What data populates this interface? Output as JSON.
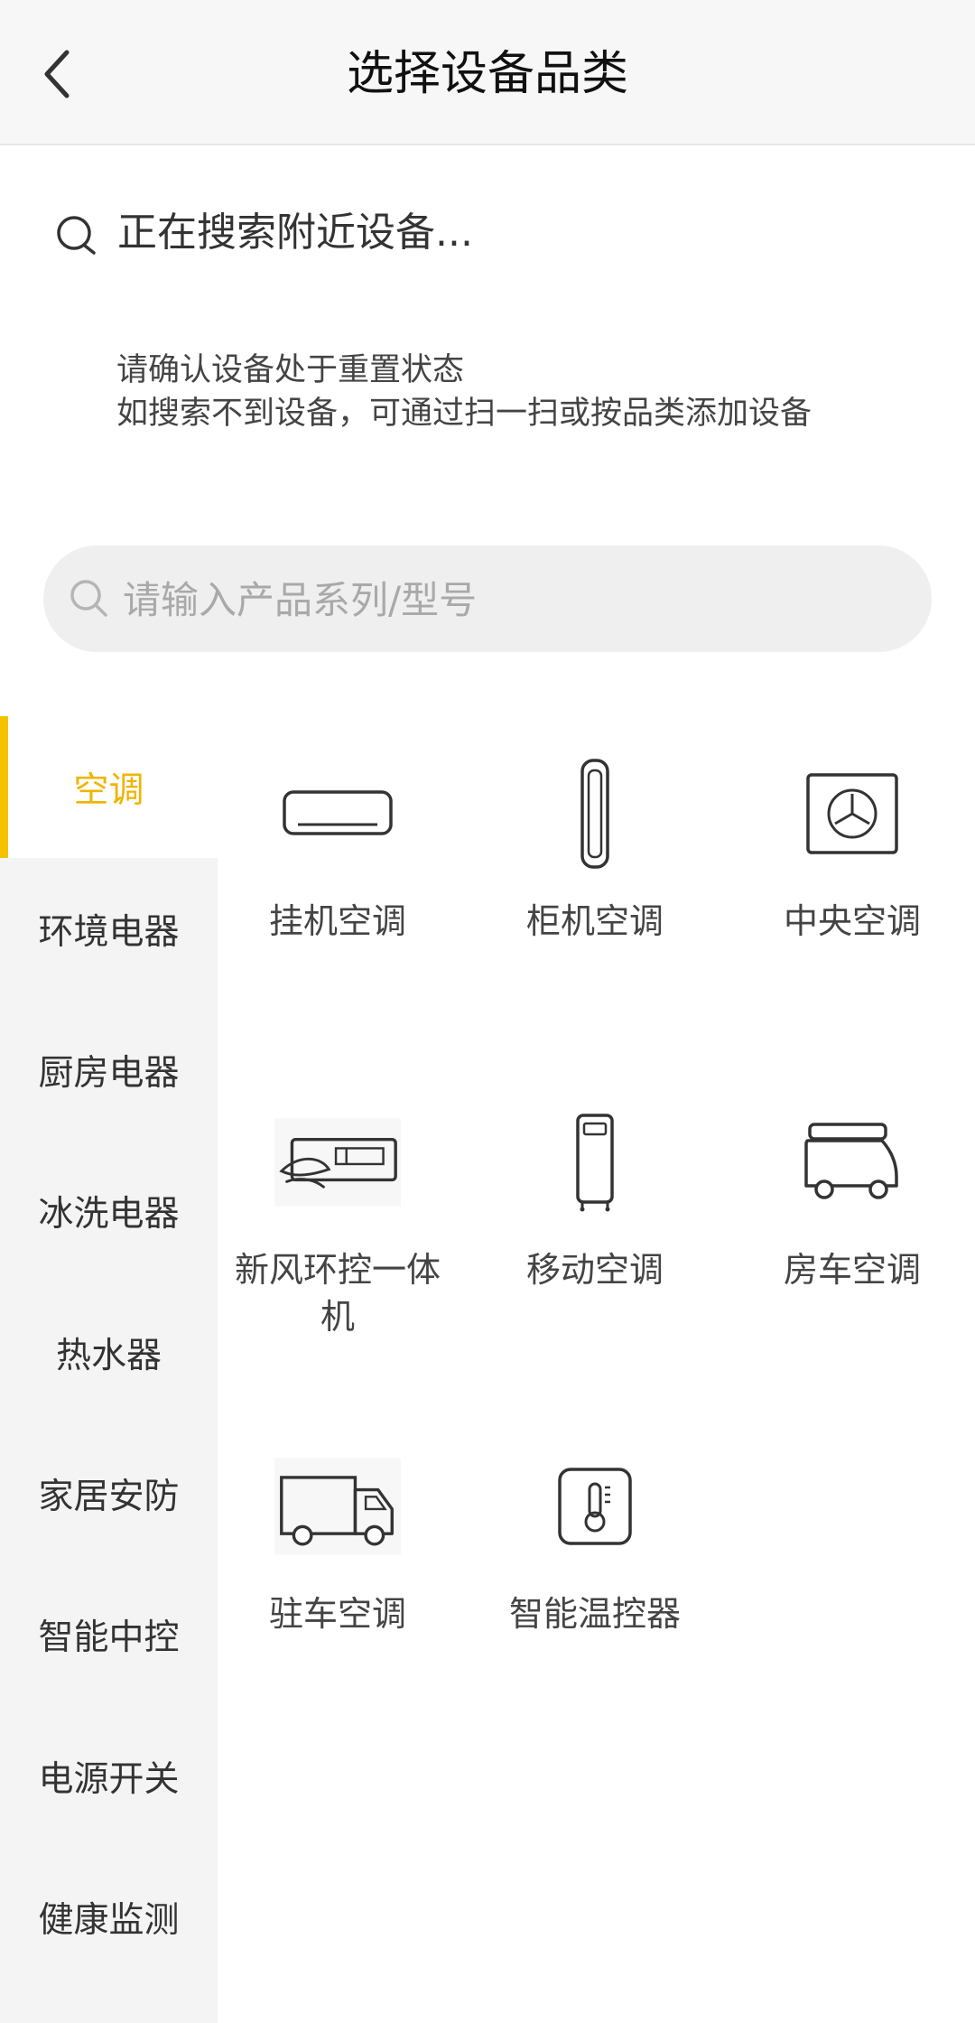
{
  "header": {
    "title": "选择设备品类"
  },
  "searching": {
    "text": "正在搜索附近设备..."
  },
  "tips": {
    "line1": "请确认设备处于重置状态",
    "line2": "如搜索不到设备，可通过扫一扫或按品类添加设备"
  },
  "search": {
    "placeholder": "请输入产品系列/型号",
    "value": ""
  },
  "sidebar": {
    "items": [
      {
        "label": "空调",
        "active": true
      },
      {
        "label": "环境电器",
        "active": false
      },
      {
        "label": "厨房电器",
        "active": false
      },
      {
        "label": "冰洗电器",
        "active": false
      },
      {
        "label": "热水器",
        "active": false
      },
      {
        "label": "家居安防",
        "active": false
      },
      {
        "label": "智能中控",
        "active": false
      },
      {
        "label": "电源开关",
        "active": false
      },
      {
        "label": "健康监测",
        "active": false
      }
    ]
  },
  "categories": [
    {
      "label": "挂机空调",
      "icon": "wall-ac-icon"
    },
    {
      "label": "柜机空调",
      "icon": "floor-ac-icon"
    },
    {
      "label": "中央空调",
      "icon": "central-ac-icon"
    },
    {
      "label": "新风环控一体机",
      "icon": "fresh-air-icon"
    },
    {
      "label": "移动空调",
      "icon": "portable-ac-icon"
    },
    {
      "label": "房车空调",
      "icon": "rv-ac-icon"
    },
    {
      "label": "驻车空调",
      "icon": "truck-ac-icon"
    },
    {
      "label": "智能温控器",
      "icon": "thermostat-icon"
    }
  ],
  "colors": {
    "accent": "#f5c200",
    "accent_text": "#f0b400",
    "sidebar_bg": "#f4f4f4",
    "header_bg": "#f7f7f7"
  }
}
